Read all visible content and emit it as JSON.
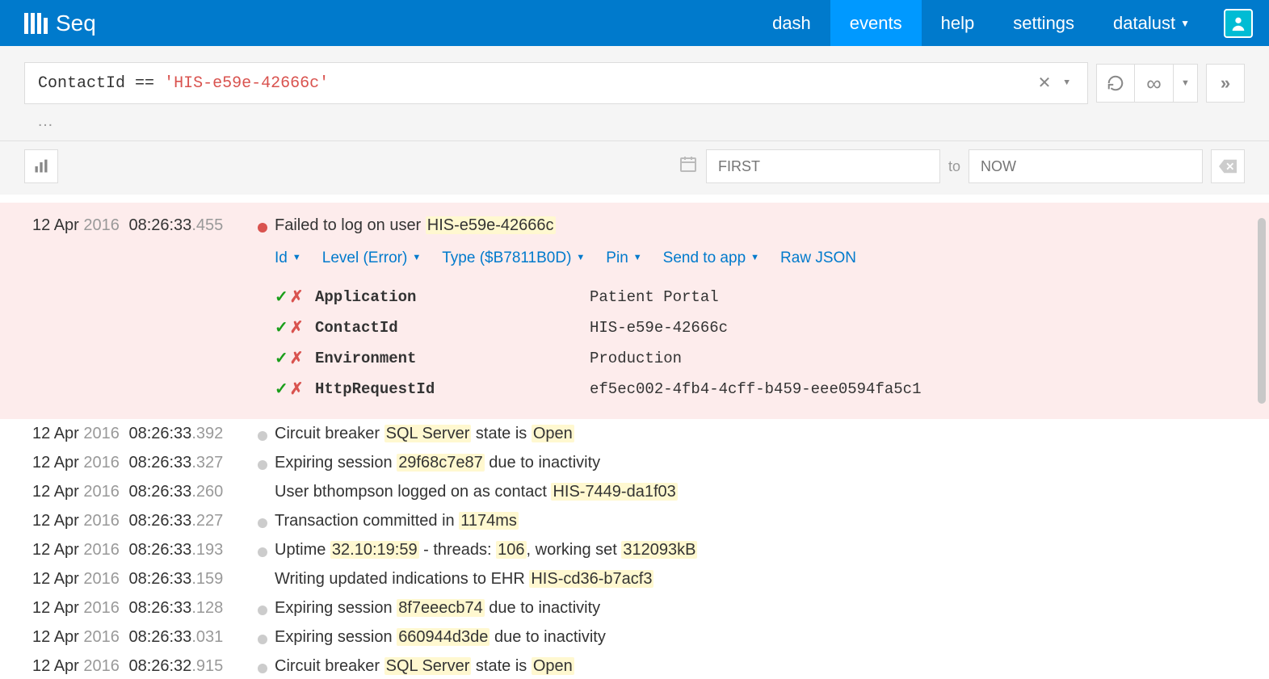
{
  "header": {
    "brand": "Seq",
    "nav": [
      {
        "label": "dash",
        "active": false
      },
      {
        "label": "events",
        "active": true
      },
      {
        "label": "help",
        "active": false
      },
      {
        "label": "settings",
        "active": false
      },
      {
        "label": "datalust",
        "active": false,
        "dropdown": true
      }
    ]
  },
  "query": {
    "property": "ContactId",
    "operator": "==",
    "value_literal": "'HIS-e59e-42666c'"
  },
  "range": {
    "first_placeholder": "FIRST",
    "to_label": "to",
    "now_placeholder": "NOW"
  },
  "expanded_event": {
    "date": "12 Apr",
    "year": "2016",
    "time": "08:26:33",
    "ms": ".455",
    "level_color": "red",
    "message_prefix": "Failed to log on user ",
    "message_hl": "HIS-e59e-42666c",
    "meta": {
      "id_label": "Id",
      "level_label": "Level (Error)",
      "type_label": "Type ($B7811B0D)",
      "pin_label": "Pin",
      "send_label": "Send to app",
      "raw_label": "Raw JSON"
    },
    "properties": [
      {
        "name": "Application",
        "value": "Patient Portal"
      },
      {
        "name": "ContactId",
        "value": "HIS-e59e-42666c"
      },
      {
        "name": "Environment",
        "value": "Production"
      },
      {
        "name": "HttpRequestId",
        "value": "ef5ec002-4fb4-4cff-b459-eee0594fa5c1"
      }
    ]
  },
  "events": [
    {
      "date": "12 Apr",
      "year": "2016",
      "time": "08:26:33",
      "ms": ".392",
      "dot": "gray",
      "parts": [
        {
          "t": "Circuit breaker "
        },
        {
          "t": "SQL Server",
          "hl": true
        },
        {
          "t": " state is "
        },
        {
          "t": "Open",
          "hl": true
        }
      ]
    },
    {
      "date": "12 Apr",
      "year": "2016",
      "time": "08:26:33",
      "ms": ".327",
      "dot": "gray",
      "parts": [
        {
          "t": "Expiring session "
        },
        {
          "t": "29f68c7e87",
          "hl": true
        },
        {
          "t": " due to inactivity"
        }
      ]
    },
    {
      "date": "12 Apr",
      "year": "2016",
      "time": "08:26:33",
      "ms": ".260",
      "dot": "none",
      "parts": [
        {
          "t": "User bthompson logged on as contact "
        },
        {
          "t": "HIS-7449-da1f03",
          "hl": true
        }
      ]
    },
    {
      "date": "12 Apr",
      "year": "2016",
      "time": "08:26:33",
      "ms": ".227",
      "dot": "gray",
      "parts": [
        {
          "t": "Transaction committed in "
        },
        {
          "t": "1174ms",
          "hl": true
        }
      ]
    },
    {
      "date": "12 Apr",
      "year": "2016",
      "time": "08:26:33",
      "ms": ".193",
      "dot": "gray",
      "parts": [
        {
          "t": "Uptime "
        },
        {
          "t": "32.10:19:59",
          "hl": true
        },
        {
          "t": " - threads: "
        },
        {
          "t": "106",
          "hl": true
        },
        {
          "t": ", working set "
        },
        {
          "t": "312093kB",
          "hl": true
        }
      ]
    },
    {
      "date": "12 Apr",
      "year": "2016",
      "time": "08:26:33",
      "ms": ".159",
      "dot": "none",
      "parts": [
        {
          "t": "Writing updated indications to EHR "
        },
        {
          "t": "HIS-cd36-b7acf3",
          "hl": true
        }
      ]
    },
    {
      "date": "12 Apr",
      "year": "2016",
      "time": "08:26:33",
      "ms": ".128",
      "dot": "gray",
      "parts": [
        {
          "t": "Expiring session "
        },
        {
          "t": "8f7eeecb74",
          "hl": true
        },
        {
          "t": " due to inactivity"
        }
      ]
    },
    {
      "date": "12 Apr",
      "year": "2016",
      "time": "08:26:33",
      "ms": ".031",
      "dot": "gray",
      "parts": [
        {
          "t": "Expiring session "
        },
        {
          "t": "660944d3de",
          "hl": true
        },
        {
          "t": " due to inactivity"
        }
      ]
    },
    {
      "date": "12 Apr",
      "year": "2016",
      "time": "08:26:32",
      "ms": ".915",
      "dot": "gray",
      "parts": [
        {
          "t": "Circuit breaker "
        },
        {
          "t": "SQL Server",
          "hl": true
        },
        {
          "t": " state is "
        },
        {
          "t": "Open",
          "hl": true
        }
      ]
    }
  ]
}
